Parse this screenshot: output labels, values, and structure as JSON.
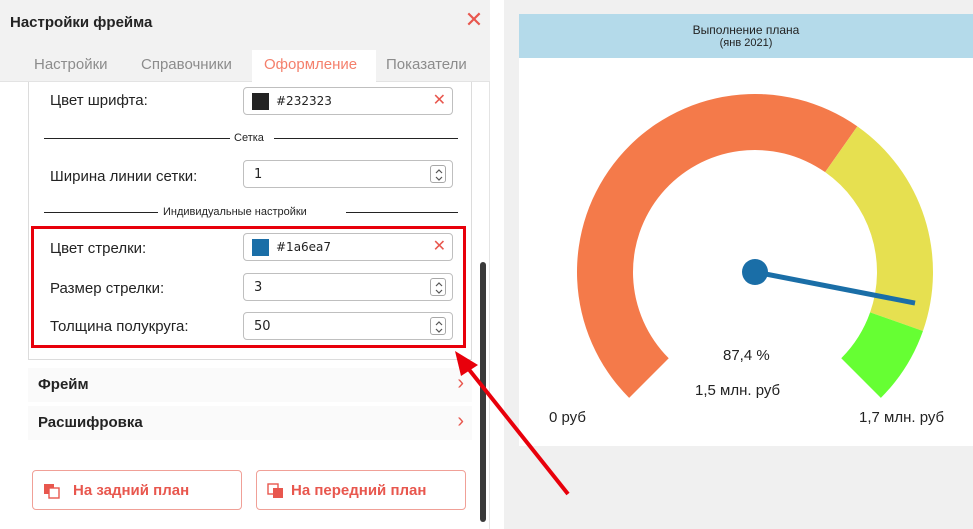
{
  "panel": {
    "title": "Настройки фрейма",
    "close_icon": "close-icon",
    "tabs": [
      {
        "label": "Настройки",
        "active": false
      },
      {
        "label": "Справочники",
        "active": false
      },
      {
        "label": "Оформление",
        "active": true
      },
      {
        "label": "Показатели",
        "active": false
      }
    ],
    "font_color": {
      "label": "Цвет шрифта:",
      "value": "#232323",
      "swatch": "#232323"
    },
    "grid_section": "Сетка",
    "grid_width": {
      "label": "Ширина линии сетки:",
      "value": "1"
    },
    "individual_section": "Индивидуальные настройки",
    "arrow_color": {
      "label": "Цвет стрелки:",
      "value": "#1a6ea7",
      "swatch": "#1a6ea7"
    },
    "arrow_size": {
      "label": "Размер стрелки:",
      "value": "3"
    },
    "semicircle_thickness": {
      "label": "Толщина полукруга:",
      "value": "50"
    },
    "accordions": [
      {
        "label": "Фрейм"
      },
      {
        "label": "Расшифровка"
      }
    ],
    "buttons": {
      "send_back": "На задний план",
      "bring_front": "На передний план"
    }
  },
  "chart_data": {
    "type": "gauge",
    "title": "Выполнение плана",
    "subtitle": "(янв 2021)",
    "min": 0,
    "max": 1.7,
    "value": 1.5,
    "percent_label": "87,4 %",
    "value_label": "1,5 млн. руб",
    "min_label": "0 руб",
    "max_label": "1,7 млн. руб",
    "bands": [
      {
        "from": 0,
        "to": 0.63,
        "color": "#f47a4a"
      },
      {
        "from": 0.63,
        "to": 0.905,
        "color": "#e6e050"
      },
      {
        "from": 0.905,
        "to": 1.0,
        "color": "#66ff33"
      }
    ],
    "needle_color": "#1a6ea7",
    "needle_fraction": 0.874
  },
  "colors": {
    "accent": "#e8574e",
    "highlight": "#e8000b",
    "header_bg": "#b4daea"
  }
}
